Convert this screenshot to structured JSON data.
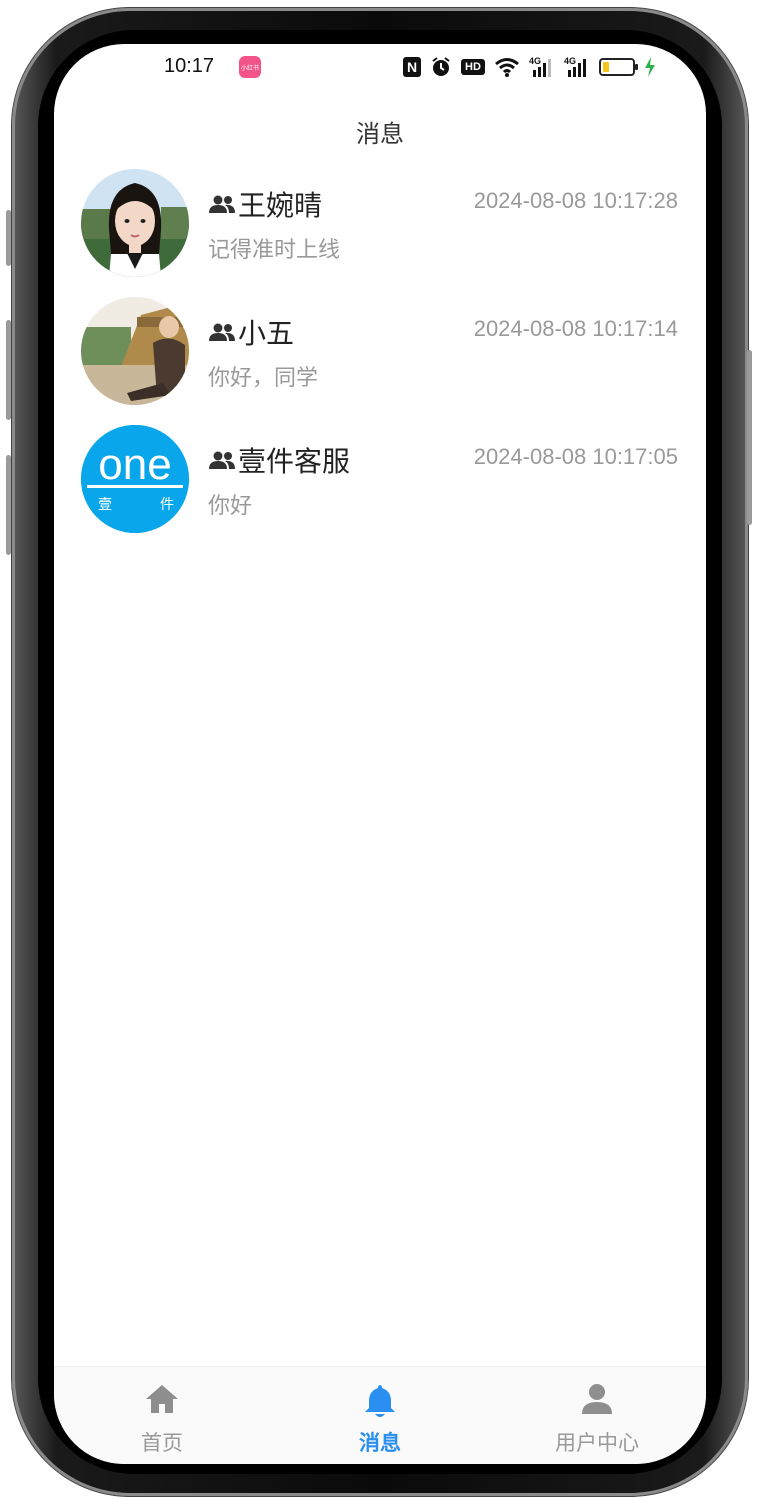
{
  "status_bar": {
    "time": "10:17",
    "signal_label_1": "4G",
    "signal_label_2": "4G",
    "hd_label": "HD"
  },
  "header": {
    "title": "消息"
  },
  "messages": [
    {
      "name": "王婉晴",
      "time": "2024-08-08 10:17:28",
      "preview": "记得准时上线"
    },
    {
      "name": "小五",
      "time": "2024-08-08 10:17:14",
      "preview": "你好，同学"
    },
    {
      "name": "壹件客服",
      "time": "2024-08-08 10:17:05",
      "preview": "你好",
      "logo_text": "one",
      "logo_sub_1": "壹",
      "logo_sub_2": "件"
    }
  ],
  "tab_bar": {
    "tabs": [
      {
        "label": "首页",
        "icon": "home-icon",
        "active": false
      },
      {
        "label": "消息",
        "icon": "bell-icon",
        "active": true
      },
      {
        "label": "用户中心",
        "icon": "user-icon",
        "active": false
      }
    ]
  },
  "colors": {
    "accent": "#2a8ff0",
    "text_primary": "#222222",
    "text_secondary": "#999999",
    "logo_blue": "#0aa6ec"
  }
}
